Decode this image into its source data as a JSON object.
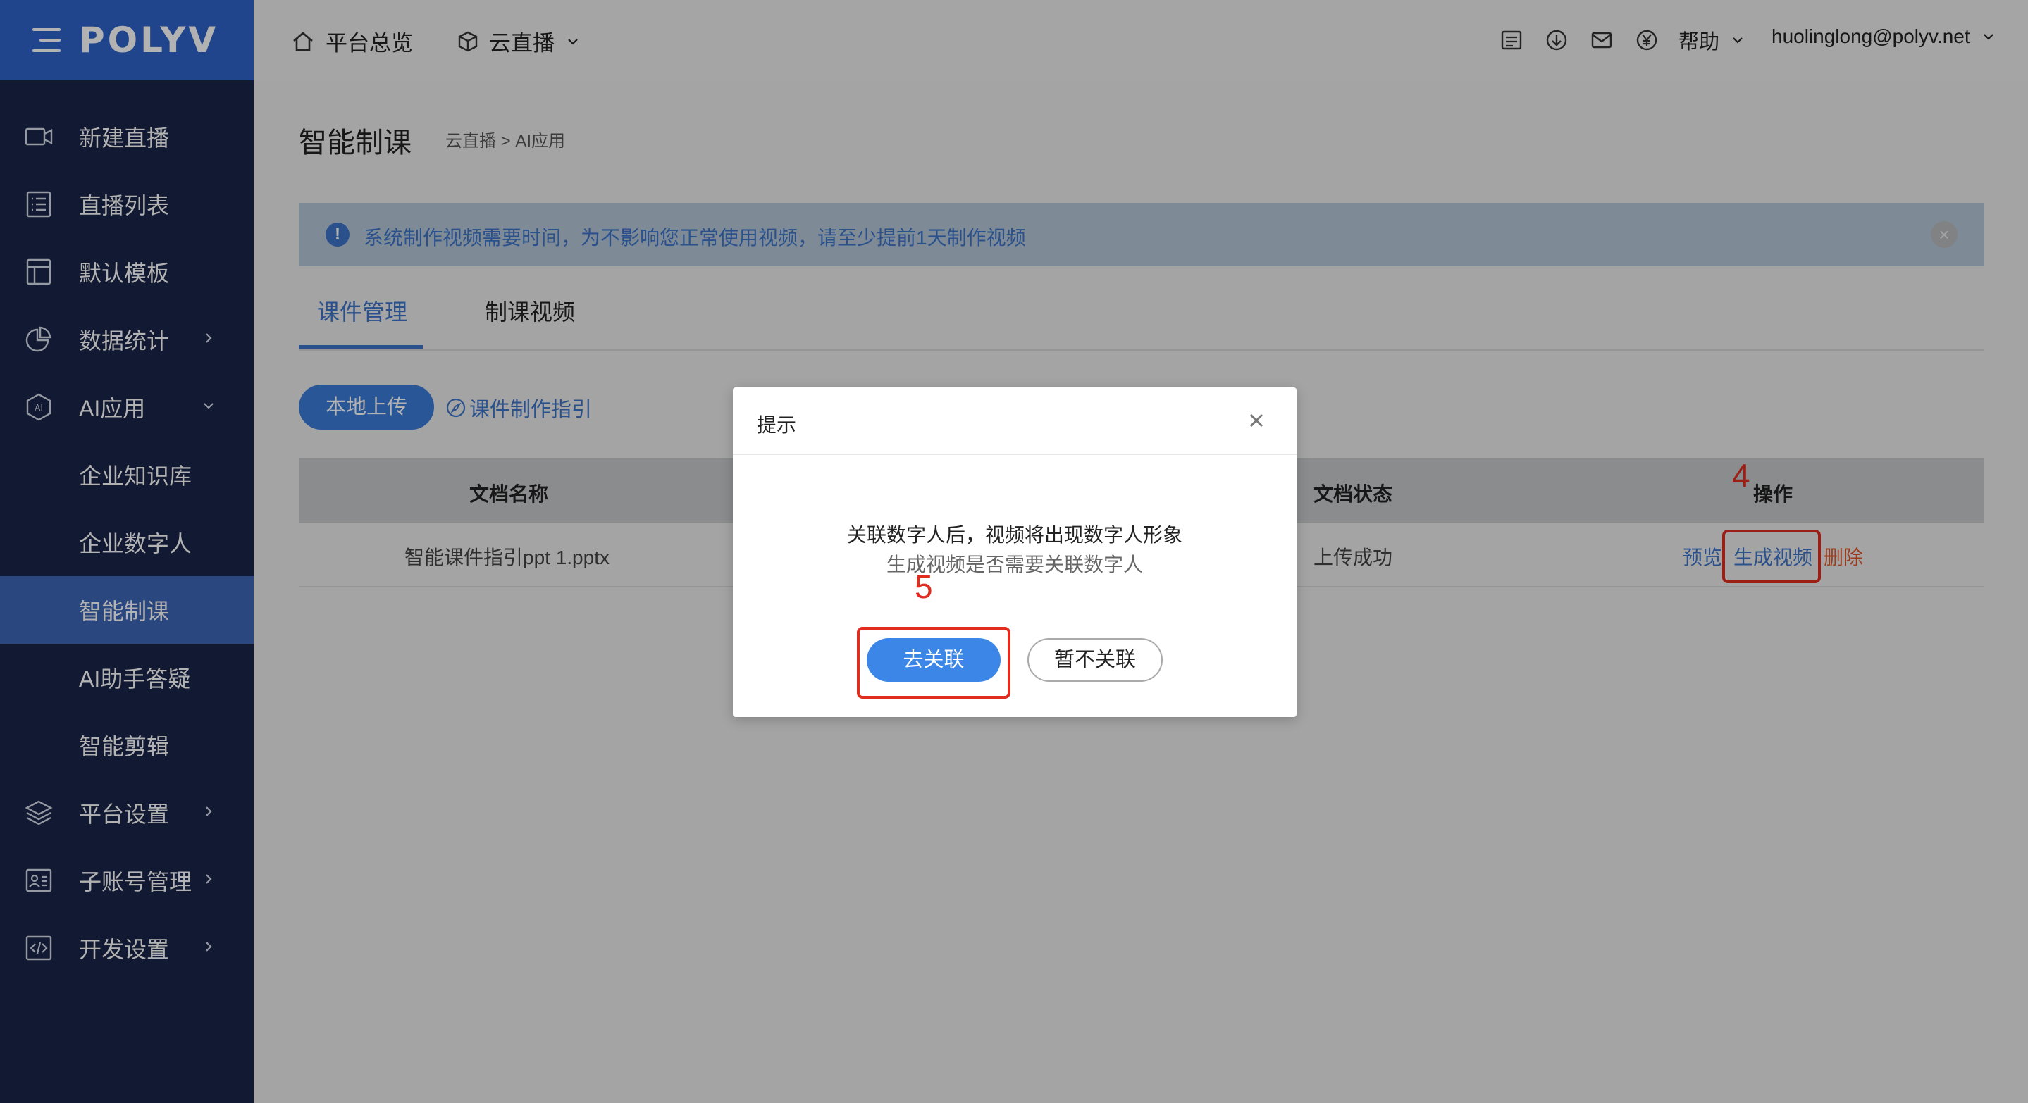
{
  "app": {
    "logo": "POLYV"
  },
  "colors": {
    "sidebar": "#1a2549",
    "brand": "#2e64c9",
    "accent": "#3d74c9",
    "annotation": "#e02d20"
  },
  "sidebar": {
    "items": [
      {
        "label": "新建直播",
        "icon": "video-camera-icon"
      },
      {
        "label": "直播列表",
        "icon": "list-icon"
      },
      {
        "label": "默认模板",
        "icon": "template-icon"
      },
      {
        "label": "数据统计",
        "icon": "pie-chart-icon"
      },
      {
        "label": "AI应用",
        "icon": "ai-hexagon-icon"
      },
      {
        "label": "企业知识库"
      },
      {
        "label": "企业数字人"
      },
      {
        "label": "智能制课"
      },
      {
        "label": "AI助手答疑"
      },
      {
        "label": "智能剪辑"
      },
      {
        "label": "平台设置",
        "icon": "layers-icon"
      },
      {
        "label": "子账号管理",
        "icon": "id-card-icon"
      },
      {
        "label": "开发设置",
        "icon": "code-icon"
      }
    ]
  },
  "topbar": {
    "home_label": "平台总览",
    "product_label": "云直播",
    "help_label": "帮助",
    "user_email": "huolinglong@polyv.net"
  },
  "page": {
    "title": "智能制课",
    "breadcrumb": "云直播 > AI应用",
    "notice": "系统制作视频需要时间，为不影响您正常使用视频，请至少提前1天制作视频",
    "tabs": [
      "课件管理",
      "制课视频"
    ],
    "upload_button": "本地上传",
    "guide_link": "课件制作指引"
  },
  "table": {
    "headers": {
      "name": "文档名称",
      "status": "文档状态",
      "actions": "操作"
    },
    "rows": [
      {
        "name": "智能课件指引ppt 1.pptx",
        "status": "上传成功",
        "preview": "预览",
        "generate": "生成视频",
        "delete": "删除"
      }
    ]
  },
  "annotations": {
    "step4": "4",
    "step5": "5"
  },
  "modal": {
    "title": "提示",
    "line1": "关联数字人后，视频将出现数字人形象",
    "line2": "生成视频是否需要关联数字人",
    "confirm": "去关联",
    "cancel": "暂不关联"
  }
}
